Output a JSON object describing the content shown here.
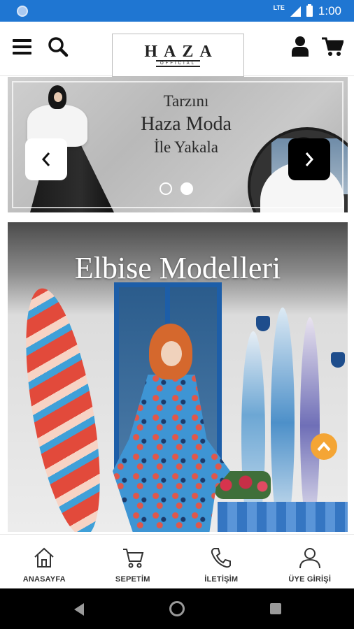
{
  "status_bar": {
    "network": "LTE",
    "time": "1:00"
  },
  "header": {
    "logo": {
      "name": "HAZA",
      "tagline": "OFFICIAL"
    },
    "icons": [
      "menu-icon",
      "search-icon",
      "user-icon",
      "cart-icon"
    ]
  },
  "slider": {
    "line1": "Tarzını",
    "line2": "Haza Moda",
    "line3": "İle Yakala",
    "prev_glyph": "‹",
    "next_glyph": "›",
    "slide_count": 2,
    "active_slide": 2
  },
  "category_banner": {
    "title": "Elbise Modelleri"
  },
  "bottom_nav": {
    "items": [
      {
        "label": "ANASAYFA",
        "icon": "home-icon"
      },
      {
        "label": "SEPETİM",
        "icon": "cart-icon"
      },
      {
        "label": "İLETİŞİM",
        "icon": "phone-icon"
      },
      {
        "label": "ÜYE GİRİŞİ",
        "icon": "user-icon"
      }
    ]
  },
  "colors": {
    "status_bar": "#1f76d2",
    "scroll_top": "#f4a535",
    "system_nav": "#000000"
  }
}
